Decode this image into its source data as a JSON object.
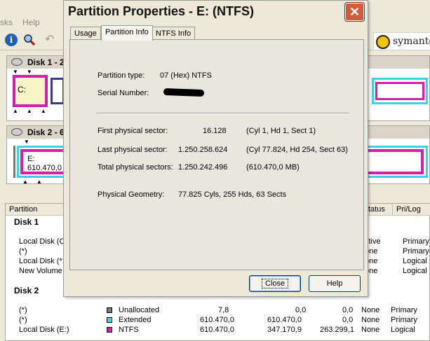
{
  "background_app": {
    "menu": [
      "sks",
      "Help"
    ],
    "toolbar_icons": [
      "info-icon",
      "search-icon",
      "undo-icon"
    ],
    "brand": "symante",
    "disk1": {
      "label": "Disk 1 - 2",
      "partition_c": "C:"
    },
    "disk2": {
      "label": "Disk 2 - 6",
      "partition_e": "E:",
      "partition_e_size": "610.470,0"
    },
    "list": {
      "columns": [
        "Partition",
        "tatus",
        "Pri/Log"
      ],
      "groups": [
        {
          "title": "Disk 1",
          "rows": [
            {
              "name": "Local Disk (C",
              "status": "ctive",
              "prilog": "Primary"
            },
            {
              "name": "(*)",
              "status": "one",
              "prilog": "Primary"
            },
            {
              "name": "Local Disk (*:",
              "status": "one",
              "prilog": "Logical"
            },
            {
              "name": "New Volume",
              "status": "one",
              "prilog": "Logical"
            }
          ]
        },
        {
          "title": "Disk 2",
          "rows": [
            {
              "name": "(*)",
              "type": "Unallocated",
              "swatch": "#7a7a7a",
              "size": "7,8",
              "used": "0,0",
              "unused": "0,0",
              "status": "None",
              "prilog": "Primary"
            },
            {
              "name": "(*)",
              "type": "Extended",
              "swatch": "#3ad3e0",
              "size": "610.470,0",
              "used": "610.470,0",
              "unused": "0,0",
              "status": "None",
              "prilog": "Primary"
            },
            {
              "name": "Local Disk (E:)",
              "type": "NTFS",
              "swatch": "#d21fb0",
              "size": "610.470,0",
              "used": "347.170,9",
              "unused": "263.299,1",
              "status": "None",
              "prilog": "Logical"
            }
          ]
        }
      ]
    }
  },
  "dialog": {
    "title": "Partition Properties - E:  (NTFS)",
    "tabs": [
      "Usage",
      "Partition Info",
      "NTFS Info"
    ],
    "active_tab": "Partition Info",
    "fields": {
      "partition_type_label": "Partition type:",
      "partition_type_value": "07 (Hex)  NTFS",
      "serial_label": "Serial Number:",
      "first_sector_label": "First physical sector:",
      "first_sector_value": "16.128",
      "first_sector_chs": "(Cyl 1, Hd 1, Sect 1)",
      "last_sector_label": "Last physical sector:",
      "last_sector_value": "1.250.258.624",
      "last_sector_chs": "(Cyl 77.824, Hd 254, Sect 63)",
      "total_sectors_label": "Total physical sectors:",
      "total_sectors_value": "1.250.242.496",
      "total_sectors_mb": "(610.470,0 MB)",
      "geometry_label": "Physical Geometry:",
      "geometry_value": "77.825 Cyls, 255 Hds, 63 Sects"
    },
    "buttons": {
      "close": "Close",
      "help": "Help"
    }
  },
  "colors": {
    "ntfs": "#d21fb0",
    "extended": "#3ad3e0",
    "fat": "#f6f4c8",
    "close_button": "#d45a3c"
  }
}
